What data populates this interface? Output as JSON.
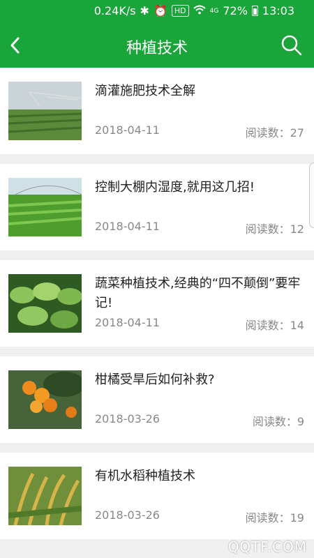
{
  "status": {
    "speed": "0.24K/s",
    "hd": "HD",
    "signal": "4G",
    "battery": "72%",
    "time": "13:03"
  },
  "header": {
    "title": "种植技术",
    "back_icon": "chevron-left-icon",
    "search_icon": "search-icon"
  },
  "articles": [
    {
      "title": "滴灌施肥技术全解",
      "date": "2018-04-11",
      "reads": "阅读数：27"
    },
    {
      "title": "控制大棚内湿度,就用这几招!",
      "date": "2018-04-11",
      "reads": "阅读数：12"
    },
    {
      "title": "蔬菜种植技术,经典的“四不颠倒”要牢记!",
      "date": "2018-04-11",
      "reads": "阅读数：14"
    },
    {
      "title": "柑橘受旱后如何补救?",
      "date": "2018-03-26",
      "reads": "阅读数：9"
    },
    {
      "title": "有机水稻种植技术",
      "date": "2018-03-26",
      "reads": "阅读数：19"
    }
  ],
  "watermark": "QQTF.COM",
  "colors": {
    "primary": "#1aa53a",
    "text": "#222222",
    "meta": "#888888"
  }
}
